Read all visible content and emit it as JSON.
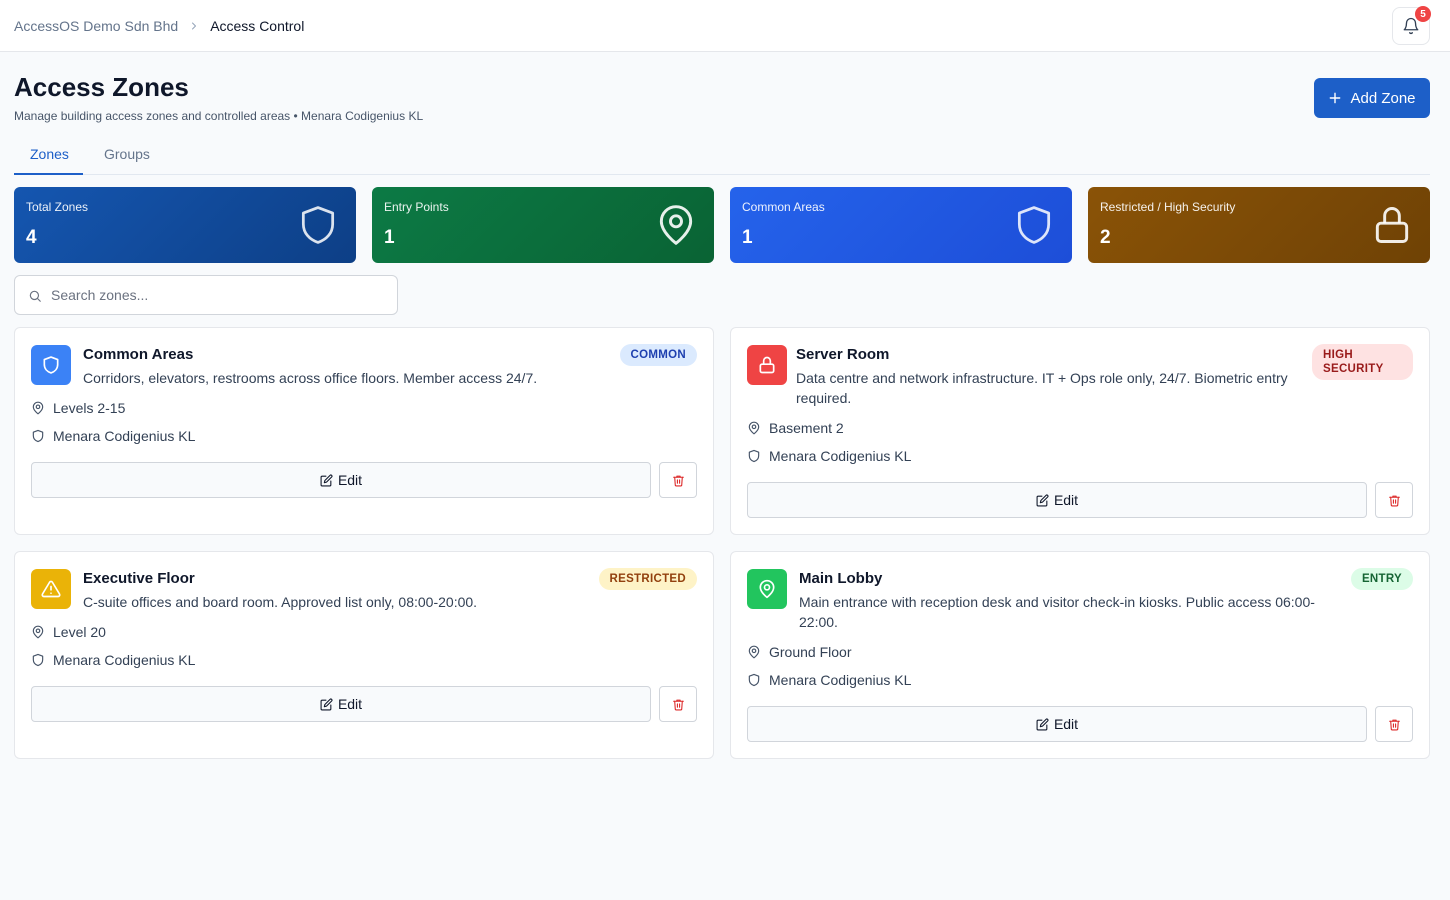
{
  "breadcrumb": {
    "org": "AccessOS Demo Sdn Bhd",
    "current": "Access Control"
  },
  "notifications": {
    "count": "5"
  },
  "header": {
    "title": "Access Zones",
    "subtitle": "Manage building access zones and controlled areas • Menara Codigenius KL",
    "add_button": "Add Zone"
  },
  "tabs": [
    {
      "label": "Zones",
      "active": true
    },
    {
      "label": "Groups",
      "active": false
    }
  ],
  "stats": [
    {
      "label": "Total Zones",
      "value": "4",
      "icon": "shield-icon",
      "color": "#1556b0"
    },
    {
      "label": "Entry Points",
      "value": "1",
      "icon": "map-pin-icon",
      "color": "#0c7a45"
    },
    {
      "label": "Common Areas",
      "value": "1",
      "icon": "shield-icon",
      "color": "#2563eb"
    },
    {
      "label": "Restricted / High Security",
      "value": "2",
      "icon": "lock-icon",
      "color": "#8a5307"
    }
  ],
  "search": {
    "placeholder": "Search zones..."
  },
  "zones": [
    {
      "name": "Common Areas",
      "description": "Corridors, elevators, restrooms across office floors. Member access 24/7.",
      "badge": "COMMON",
      "location": "Levels 2-15",
      "building": "Menara Codigenius KL",
      "icon": "shield-icon",
      "color": "#3b82f6",
      "edit_label": "Edit"
    },
    {
      "name": "Server Room",
      "description": "Data centre and network infrastructure. IT + Ops role only, 24/7. Biometric entry required.",
      "badge": "HIGH SECURITY",
      "location": "Basement 2",
      "building": "Menara Codigenius KL",
      "icon": "lock-icon",
      "color": "#ef4444",
      "edit_label": "Edit"
    },
    {
      "name": "Executive Floor",
      "description": "C-suite offices and board room. Approved list only, 08:00-20:00.",
      "badge": "RESTRICTED",
      "location": "Level 20",
      "building": "Menara Codigenius KL",
      "icon": "warning-icon",
      "color": "#eab308",
      "edit_label": "Edit"
    },
    {
      "name": "Main Lobby",
      "description": "Main entrance with reception desk and visitor check-in kiosks. Public access 06:00-22:00.",
      "badge": "ENTRY",
      "location": "Ground Floor",
      "building": "Menara Codigenius KL",
      "icon": "map-pin-icon",
      "color": "#22c55e",
      "edit_label": "Edit"
    }
  ]
}
